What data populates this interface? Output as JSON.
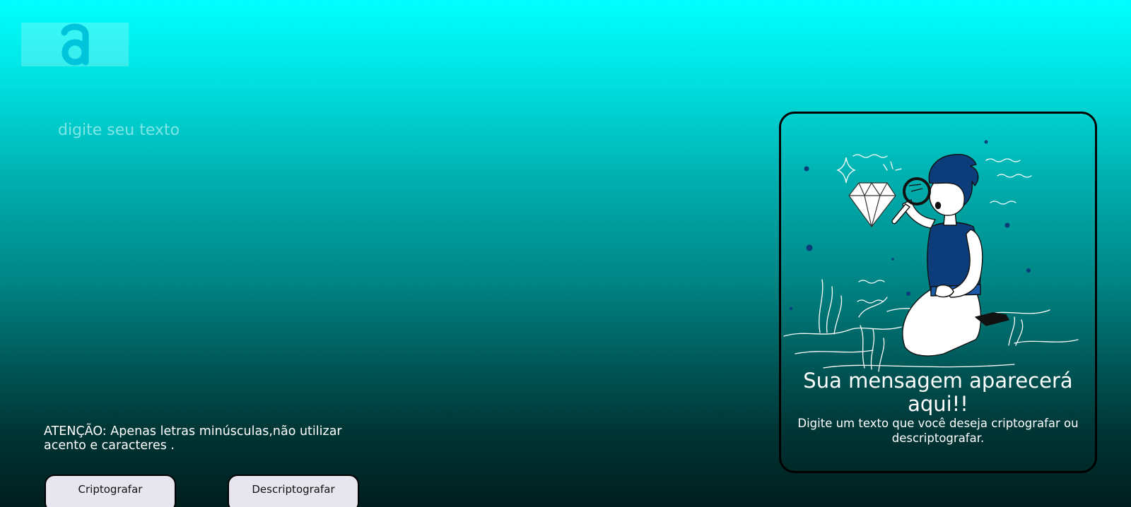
{
  "header": {
    "logo_icon": "letter-a-logo-icon"
  },
  "input": {
    "placeholder": "digite seu texto",
    "value": ""
  },
  "warning": {
    "text": "ATENÇÃO: Apenas letras minúsculas,não utilizar acento e caracteres ."
  },
  "buttons": {
    "encrypt_label": "Criptografar",
    "decrypt_label": "Descriptografar"
  },
  "output": {
    "illustration_icon": "person-with-magnifying-glass-icon",
    "title": "Sua mensagem aparecerá aqui!!",
    "subtitle": "Digite um texto que você deseja criptografar ou descriptografar."
  },
  "colors": {
    "gradient_top": "#00ffff",
    "gradient_bottom": "#001e1e",
    "logo": "#00c4dc",
    "figure_shirt": "#0c3d7a",
    "button_bg": "#e7e6ee"
  }
}
